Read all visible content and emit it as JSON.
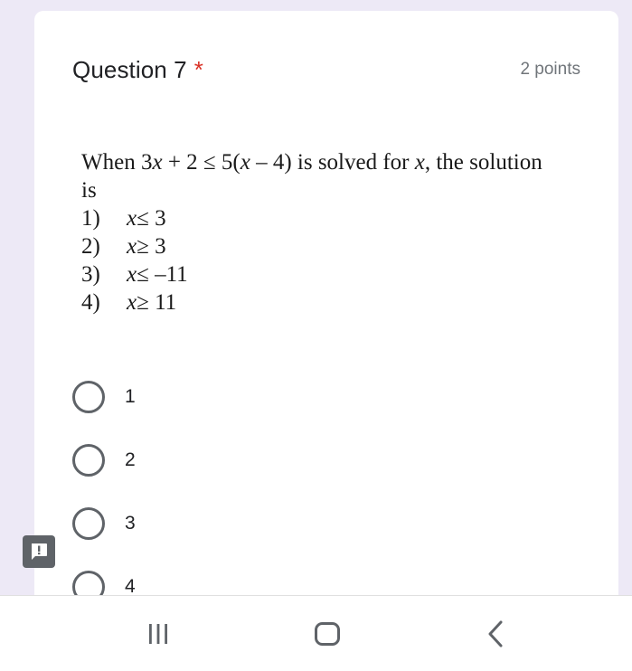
{
  "question": {
    "title": "Question 7",
    "required_marker": "*",
    "points": "2 points",
    "image_text": {
      "line1_prefix": "When 3",
      "line1_var1": "x",
      "line1_mid": " + 2 ≤ 5(",
      "line1_var2": "x",
      "line1_mid2": " – 4) is solved for ",
      "line1_var3": "x",
      "line1_suffix": ", the solution",
      "line2": "is",
      "choices": [
        {
          "num": "1)",
          "var": "x",
          "rest": " ≤ 3"
        },
        {
          "num": "2)",
          "var": "x",
          "rest": " ≥ 3"
        },
        {
          "num": "3)",
          "var": "x",
          "rest": " ≤ –11"
        },
        {
          "num": "4)",
          "var": "x",
          "rest": " ≥ 11"
        }
      ]
    },
    "options": [
      {
        "label": "1",
        "selected": false
      },
      {
        "label": "2",
        "selected": false
      },
      {
        "label": "3",
        "selected": false
      },
      {
        "label": "4",
        "selected": false
      }
    ]
  },
  "report_badge": {
    "icon": "exclamation-icon"
  },
  "navbar": {
    "icons": [
      "recent-apps-icon",
      "home-icon",
      "back-icon"
    ]
  },
  "colors": {
    "background": "#ede9f6",
    "card": "#ffffff",
    "required": "#d93025",
    "radio_border": "#5f6368"
  }
}
